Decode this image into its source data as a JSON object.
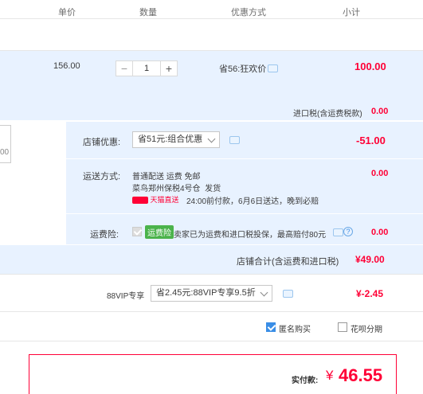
{
  "header": {
    "price": "单价",
    "qty": "数量",
    "discount": "优惠方式",
    "subtotal": "小计"
  },
  "item": {
    "price": "156.00",
    "qty": "1",
    "minus": "−",
    "plus": "+",
    "discount": "省56:狂欢价",
    "subtotal": "100.00"
  },
  "tax": {
    "label": "进口税(含运费税款)",
    "value": "0.00"
  },
  "shop_discount": {
    "label": "店铺优惠:",
    "selected": "省51元:组合优惠",
    "value": "-51.00"
  },
  "shipping": {
    "label": "运送方式:",
    "line1": "普通配送 运费 免邮",
    "line2_a": "菜鸟郑州保税4号仓",
    "line2_b": "发货",
    "badge": "天猫直送",
    "line3": "24:00前付款，6月6日送达，晚到必赔",
    "value": "0.00"
  },
  "insurance": {
    "label": "运费险:",
    "badge": "运费险",
    "text": "卖家已为运费和进口税投保，最高赔付80元",
    "help": "?",
    "value": "0.00"
  },
  "shop_total": {
    "label": "店铺合计(含运费和进口税)",
    "value": "¥49.00"
  },
  "vip": {
    "label": "88VIP专享",
    "selected": "省2.45元:88VIP专享9.5折",
    "value": "¥-2.45"
  },
  "options": {
    "anonymous": "匿名购买",
    "huabei": "花呗分期"
  },
  "pay": {
    "label": "实付款:",
    "currency": "¥",
    "value": "46.55"
  },
  "left_partial": "00",
  "colors": {
    "accent": "#ff0036",
    "blue_bg": "#e8f2ff",
    "checkbox": "#3a8ee6"
  }
}
